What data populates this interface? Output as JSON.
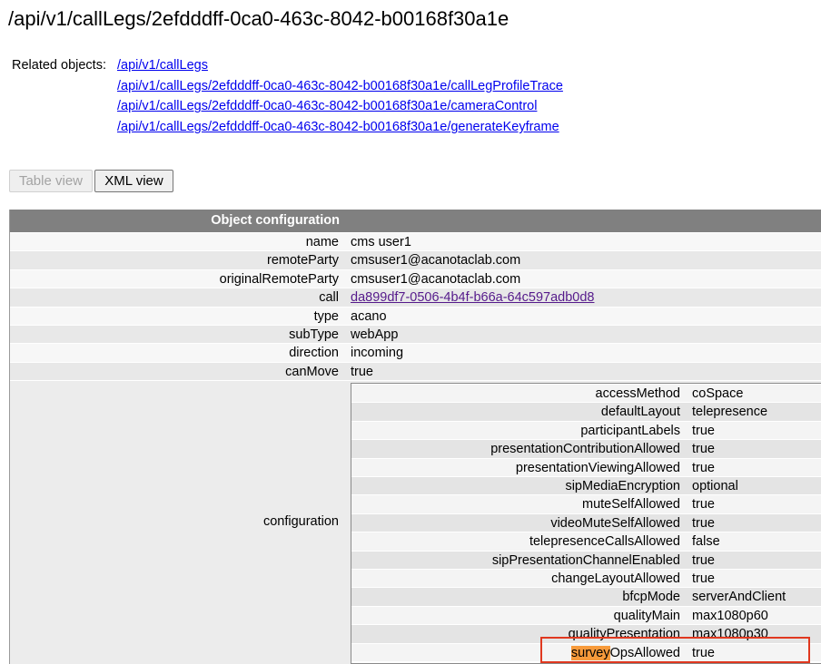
{
  "page": {
    "title": "/api/v1/callLegs/2efdddff-0ca0-463c-8042-b00168f30a1e"
  },
  "related": {
    "label": "Related objects:",
    "links": [
      "/api/v1/callLegs",
      "/api/v1/callLegs/2efdddff-0ca0-463c-8042-b00168f30a1e/callLegProfileTrace",
      "/api/v1/callLegs/2efdddff-0ca0-463c-8042-b00168f30a1e/cameraControl",
      "/api/v1/callLegs/2efdddff-0ca0-463c-8042-b00168f30a1e/generateKeyframe"
    ]
  },
  "view": {
    "table_label": "Table view",
    "xml_label": "XML view"
  },
  "config": {
    "header": "Object configuration",
    "rows": [
      {
        "key": "name",
        "value": "cms user1"
      },
      {
        "key": "remoteParty",
        "value": "cmsuser1@acanotaclab.com"
      },
      {
        "key": "originalRemoteParty",
        "value": "cmsuser1@acanotaclab.com"
      },
      {
        "key": "call",
        "value": "da899df7-0506-4b4f-b66a-64c597adb0d8"
      },
      {
        "key": "type",
        "value": "acano"
      },
      {
        "key": "subType",
        "value": "webApp"
      },
      {
        "key": "direction",
        "value": "incoming"
      },
      {
        "key": "canMove",
        "value": "true"
      }
    ],
    "configuration_label": "configuration",
    "nested": [
      {
        "key": "accessMethod",
        "value": "coSpace"
      },
      {
        "key": "defaultLayout",
        "value": "telepresence"
      },
      {
        "key": "participantLabels",
        "value": "true"
      },
      {
        "key": "presentationContributionAllowed",
        "value": "true"
      },
      {
        "key": "presentationViewingAllowed",
        "value": "true"
      },
      {
        "key": "sipMediaEncryption",
        "value": "optional"
      },
      {
        "key": "muteSelfAllowed",
        "value": "true"
      },
      {
        "key": "videoMuteSelfAllowed",
        "value": "true"
      },
      {
        "key": "telepresenceCallsAllowed",
        "value": "false"
      },
      {
        "key": "sipPresentationChannelEnabled",
        "value": "true"
      },
      {
        "key": "changeLayoutAllowed",
        "value": "true"
      },
      {
        "key": "bfcpMode",
        "value": "serverAndClient"
      },
      {
        "key": "qualityMain",
        "value": "max1080p60"
      },
      {
        "key": "qualityPresentation",
        "value": "max1080p30"
      }
    ],
    "last_row": {
      "key_highlight": "survey",
      "key_rest": "OpsAllowed",
      "value": "true"
    }
  },
  "colors": {
    "link": "#0000ee",
    "visited_link": "#551a8b",
    "header_bg": "#808080",
    "highlight": "#f79a3b",
    "annotation_box": "#e0381f"
  }
}
